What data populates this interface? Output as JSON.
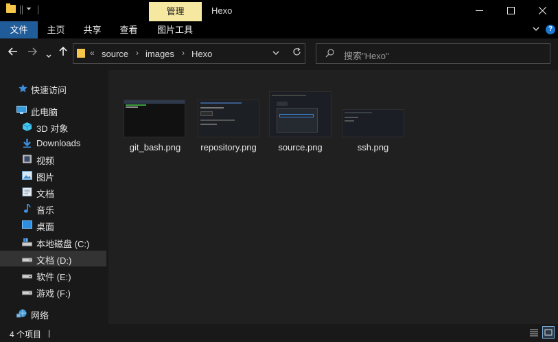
{
  "titlebar": {
    "context_tab": "管理",
    "title": "Hexo",
    "minimize": "—",
    "maximize": "☐",
    "close": "✕"
  },
  "ribbon": {
    "tabs": [
      "文件",
      "主页",
      "共享",
      "查看",
      "图片工具"
    ],
    "help": "?"
  },
  "nav": {
    "breadcrumb": [
      "source",
      "images",
      "Hexo"
    ],
    "overflow": "«",
    "search_placeholder": "搜索\"Hexo\""
  },
  "sidebar": {
    "items": [
      {
        "label": "快速访问",
        "icon": "star-icon"
      },
      {
        "label": "此电脑",
        "icon": "computer-icon"
      },
      {
        "label": "3D 对象",
        "icon": "cube-icon"
      },
      {
        "label": "Downloads",
        "icon": "download-icon"
      },
      {
        "label": "视频",
        "icon": "video-icon"
      },
      {
        "label": "图片",
        "icon": "picture-icon"
      },
      {
        "label": "文档",
        "icon": "document-icon"
      },
      {
        "label": "音乐",
        "icon": "music-icon"
      },
      {
        "label": "桌面",
        "icon": "desktop-icon"
      },
      {
        "label": "本地磁盘 (C:)",
        "icon": "drive-icon"
      },
      {
        "label": "文档 (D:)",
        "icon": "drive-icon"
      },
      {
        "label": "软件 (E:)",
        "icon": "drive-icon"
      },
      {
        "label": "游戏 (F:)",
        "icon": "drive-icon"
      },
      {
        "label": "网络",
        "icon": "network-icon"
      }
    ]
  },
  "files": [
    {
      "name": "git_bash.png"
    },
    {
      "name": "repository.png"
    },
    {
      "name": "source.png"
    },
    {
      "name": "ssh.png"
    }
  ],
  "status": {
    "count": "4 个项目",
    "cursor": "|"
  }
}
